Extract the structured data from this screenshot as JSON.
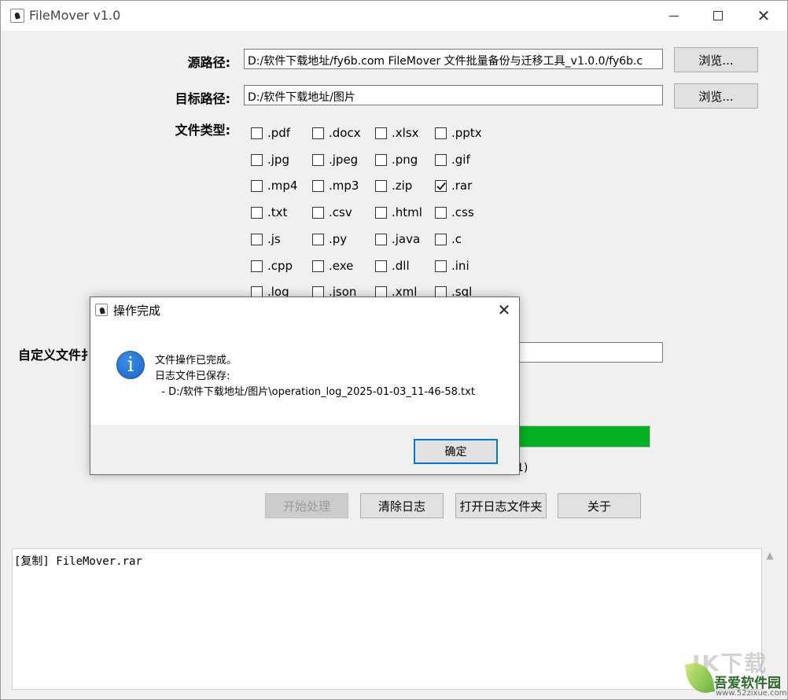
{
  "window": {
    "title": "FileMover v1.0"
  },
  "source": {
    "label": "源路径:",
    "value": "D:/软件下载地址/fy6b.com FileMover 文件批量备份与迁移工具_v1.0.0/fy6b.c",
    "browse": "浏览..."
  },
  "target": {
    "label": "目标路径:",
    "value": "D:/软件下载地址/图片",
    "browse": "浏览..."
  },
  "filetypes": {
    "label": "文件类型:",
    "items": [
      {
        "ext": ".pdf",
        "checked": false
      },
      {
        "ext": ".docx",
        "checked": false
      },
      {
        "ext": ".xlsx",
        "checked": false
      },
      {
        "ext": ".pptx",
        "checked": false
      },
      {
        "ext": ".jpg",
        "checked": false
      },
      {
        "ext": ".jpeg",
        "checked": false
      },
      {
        "ext": ".png",
        "checked": false
      },
      {
        "ext": ".gif",
        "checked": false
      },
      {
        "ext": ".mp4",
        "checked": false
      },
      {
        "ext": ".mp3",
        "checked": false
      },
      {
        "ext": ".zip",
        "checked": false
      },
      {
        "ext": ".rar",
        "checked": true
      },
      {
        "ext": ".txt",
        "checked": false
      },
      {
        "ext": ".csv",
        "checked": false
      },
      {
        "ext": ".html",
        "checked": false
      },
      {
        "ext": ".css",
        "checked": false
      },
      {
        "ext": ".js",
        "checked": false
      },
      {
        "ext": ".py",
        "checked": false
      },
      {
        "ext": ".java",
        "checked": false
      },
      {
        "ext": ".c",
        "checked": false
      },
      {
        "ext": ".cpp",
        "checked": false
      },
      {
        "ext": ".exe",
        "checked": false
      },
      {
        "ext": ".dll",
        "checked": false
      },
      {
        "ext": ".ini",
        "checked": false
      },
      {
        "ext": ".log",
        "checked": false
      },
      {
        "ext": ".json",
        "checked": false
      },
      {
        "ext": ".xml",
        "checked": false
      },
      {
        "ext": ".sql",
        "checked": false
      }
    ]
  },
  "custom": {
    "label": "自定义文件扌",
    "value": ""
  },
  "progress": {
    "fraction": 1.0,
    "tail_text": "1)"
  },
  "buttons": {
    "start": "开始处理",
    "clear_log": "清除日志",
    "open_log_folder": "打开日志文件夹",
    "about": "关于"
  },
  "log": {
    "lines": [
      "[复制] FileMover.rar"
    ]
  },
  "dialog": {
    "title": "操作完成",
    "icon": "info-icon",
    "line1": "文件操作已完成。",
    "line2": "日志文件已保存:",
    "line3": "  - D:/软件下载地址/图片\\operation_log_2025-01-03_11-46-58.txt",
    "ok": "确定"
  },
  "watermark": {
    "big": "JK下载",
    "main": "吾爱软件园",
    "url": "www.52zixue.com"
  },
  "colors": {
    "progress": "#06b025",
    "dialog_ok_border": "#0078d7",
    "info_icon": "#1a64c8"
  }
}
